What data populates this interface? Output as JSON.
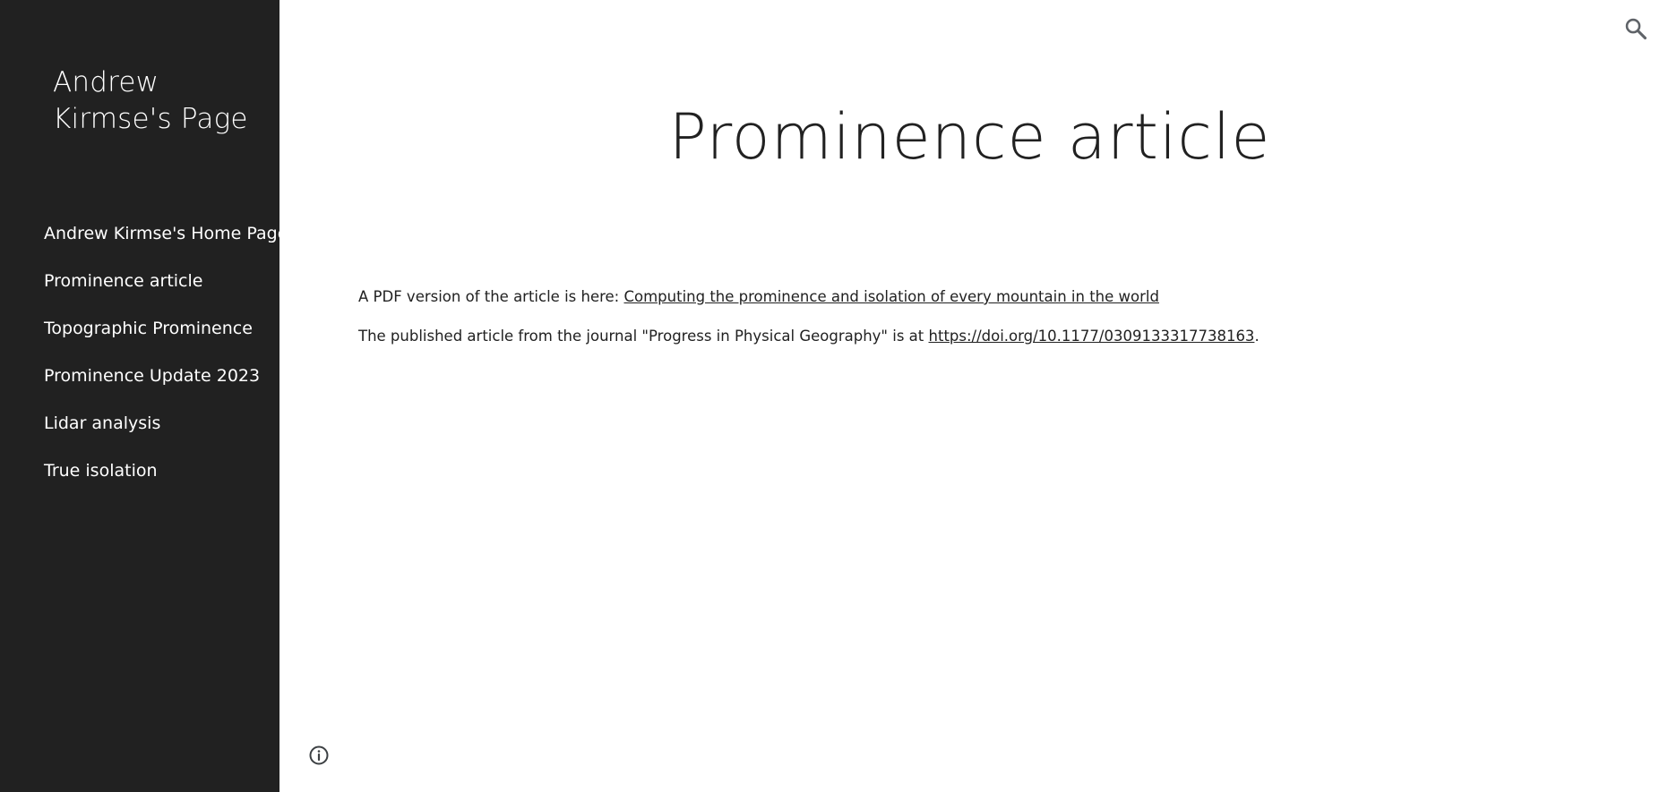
{
  "site": {
    "title": "Andrew Kirmse's Page"
  },
  "sidebar": {
    "items": [
      {
        "label": "Andrew Kirmse's Home Page"
      },
      {
        "label": "Prominence article"
      },
      {
        "label": "Topographic Prominence"
      },
      {
        "label": "Prominence Update 2023"
      },
      {
        "label": "Lidar analysis"
      },
      {
        "label": "True isolation"
      }
    ]
  },
  "main": {
    "title": "Prominence article",
    "paragraph1": {
      "text": "A PDF version of the article is here: ",
      "link": "Computing the prominence and isolation of every mountain in the world"
    },
    "paragraph2": {
      "text": "The published article from the journal \"Progress in Physical Geography\" is at ",
      "link": "https://doi.org/10.1177/0309133317738163",
      "suffix": "."
    }
  },
  "icons": {
    "search": "search-icon",
    "info": "info-icon"
  },
  "colors": {
    "sidebar_background": "#212121",
    "sidebar_text": "#ffffff",
    "page_background": "#ffffff",
    "body_text": "#212121"
  }
}
